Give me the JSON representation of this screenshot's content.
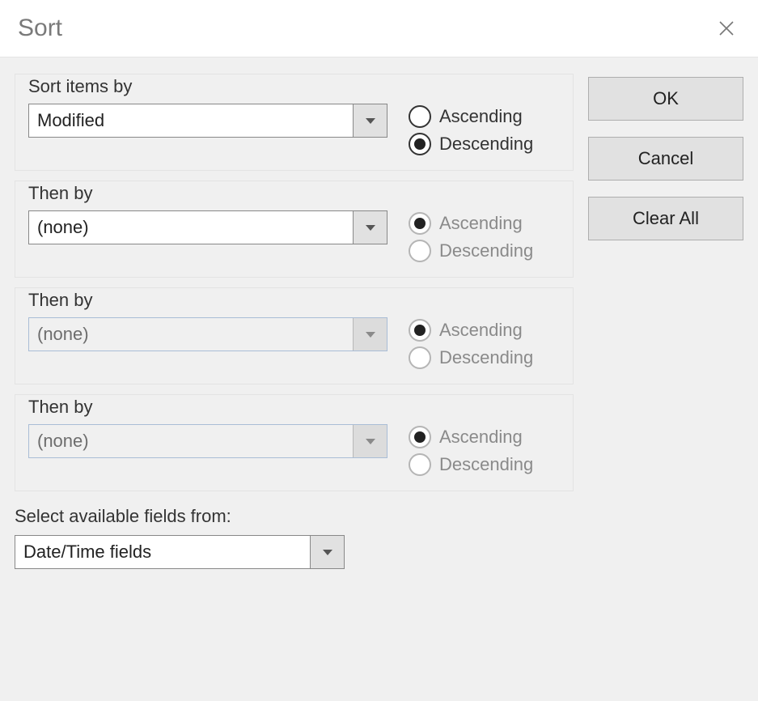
{
  "title": "Sort",
  "buttons": {
    "ok": "OK",
    "cancel": "Cancel",
    "clear_all": "Clear All"
  },
  "radios": {
    "ascending": "Ascending",
    "descending": "Descending"
  },
  "groups": [
    {
      "label": "Sort items by",
      "value": "Modified",
      "enabled": true,
      "selected": "descending"
    },
    {
      "label": "Then by",
      "value": "(none)",
      "enabled": true,
      "selected": "ascending"
    },
    {
      "label": "Then by",
      "value": "(none)",
      "enabled": false,
      "selected": "ascending"
    },
    {
      "label": "Then by",
      "value": "(none)",
      "enabled": false,
      "selected": "ascending"
    }
  ],
  "fields_from": {
    "label": "Select available fields from:",
    "value": "Date/Time fields"
  }
}
